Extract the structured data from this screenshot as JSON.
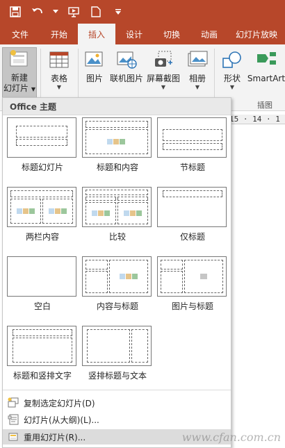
{
  "colors": {
    "accent": "#b7472a",
    "ribbon_bg": "#f3f3f3"
  },
  "quick_access": [
    {
      "icon": "save-icon"
    },
    {
      "icon": "undo-icon"
    },
    {
      "icon": "start-from-beginning-icon"
    },
    {
      "icon": "new-file-icon"
    },
    {
      "icon": "customize-dropdown-icon"
    }
  ],
  "tabs": [
    "文件",
    "开始",
    "插入",
    "设计",
    "切换",
    "动画",
    "幻灯片放映"
  ],
  "active_tab": "插入",
  "ribbon": {
    "new_slide": {
      "line1": "新建",
      "line2": "幻灯片"
    },
    "table": "表格",
    "picture": "图片",
    "online_picture": "联机图片",
    "screenshot": "屏幕截图",
    "album": "相册",
    "shapes": "形状",
    "smartart": "SmartArt",
    "illustrations_group": "插图"
  },
  "ruler_text": "15 · 14 · 1",
  "gallery": {
    "header": "Office 主题",
    "layouts": [
      "标题幻灯片",
      "标题和内容",
      "节标题",
      "两栏内容",
      "比较",
      "仅标题",
      "空白",
      "内容与标题",
      "图片与标题",
      "标题和竖排文字",
      "竖排标题与文本"
    ],
    "menu": [
      {
        "label": "复制选定幻灯片(D)",
        "icon": "duplicate-slide-icon"
      },
      {
        "label": "幻灯片(从大纲)(L)...",
        "icon": "outline-slides-icon"
      },
      {
        "label": "重用幻灯片(R)...",
        "icon": "reuse-slides-icon"
      }
    ]
  },
  "watermark": "www.cfan.com.cn"
}
